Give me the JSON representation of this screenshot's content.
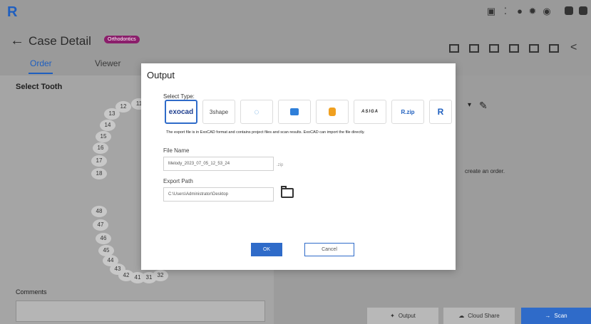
{
  "app": {
    "logo_letter": "R"
  },
  "header": {
    "back_icon": "arrow-left-icon",
    "title": "Case Detail",
    "badge": "Orthodontics",
    "tabs": [
      {
        "label": "Order"
      },
      {
        "label": "Viewer"
      }
    ]
  },
  "left": {
    "select_tooth": "Select Tooth",
    "teeth_upper": [
      "11",
      "12",
      "13",
      "14",
      "15",
      "16",
      "17",
      "18"
    ],
    "teeth_lower": [
      "48",
      "47",
      "46",
      "45",
      "44",
      "43",
      "42",
      "41",
      "31",
      "32"
    ],
    "comments_label": "Comments"
  },
  "right": {
    "hint": "create an order."
  },
  "bottom": {
    "output": "Output",
    "cloud_share": "Cloud Share",
    "scan": "Scan"
  },
  "modal": {
    "title": "Output",
    "select_type": "Select Type:",
    "formats": [
      {
        "label": "exocad",
        "selected": true
      },
      {
        "label": "3shape",
        "selected": false
      },
      {
        "label": "",
        "selected": false
      },
      {
        "label": "",
        "selected": false
      },
      {
        "label": "",
        "selected": false
      },
      {
        "label": "ASIGA",
        "selected": false
      },
      {
        "label": "R.zip",
        "selected": false
      },
      {
        "label": "R",
        "selected": false
      }
    ],
    "description": "The export file is in ExoCAD format and contains project files and scan results. ExoCAD can import the file directly.",
    "file_name_label": "File Name",
    "file_name_value": "Melody_2023_07_05_12_53_24",
    "file_ext": ".zip",
    "export_path_label": "Export Path",
    "export_path_value": "C:\\Users\\Administrator\\Desktop",
    "ok": "OK",
    "cancel": "Cancel"
  },
  "colors": {
    "accent": "#2f6bc9",
    "badge": "#8b1e6b",
    "overlay": "#9a9a9a"
  }
}
